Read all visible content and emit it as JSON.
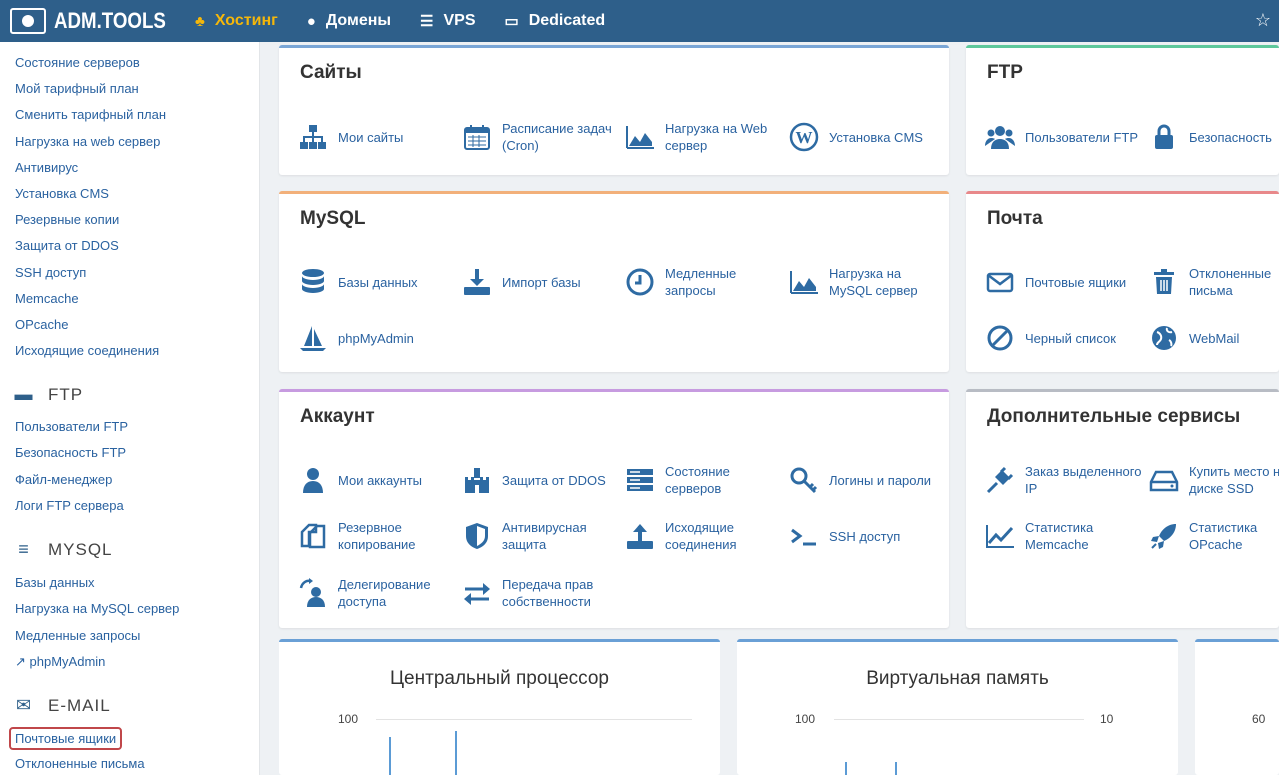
{
  "header": {
    "logo_text": "ADM.TOOLS",
    "nav": [
      {
        "label": "Хостинг",
        "icon": "sitemap-icon",
        "active": true
      },
      {
        "label": "Домены",
        "icon": "globe-icon",
        "active": false
      },
      {
        "label": "VPS",
        "icon": "server-icon",
        "active": false
      },
      {
        "label": "Dedicated",
        "icon": "hdd-icon",
        "active": false
      }
    ],
    "accent_color": "#f5b70a",
    "bar_color": "#2e5f8a"
  },
  "sidebar": {
    "hosting_links": [
      "Состояние серверов",
      "Мой тарифный план",
      "Сменить тарифный план",
      "Нагрузка на web сервер",
      "Антивирус",
      "Установка CMS",
      "Резервные копии",
      "Защита от DDOS",
      "SSH доступ",
      "Memcache",
      "OPcache",
      "Исходящие соединения"
    ],
    "ftp_title": "FTP",
    "ftp_links": [
      "Пользователи FTP",
      "Безопасность FTP",
      "Файл-менеджер",
      "Логи FTP сервера"
    ],
    "mysql_title": "MYSQL",
    "mysql_links": [
      "Базы данных",
      "Нагрузка на MySQL сервер",
      "Медленные запросы",
      "phpMyAdmin"
    ],
    "email_title": "E-MAIL",
    "email_links": [
      "Почтовые ящики",
      "Отклоненные письма"
    ]
  },
  "cards": {
    "sites": {
      "title": "Сайты",
      "tiles": [
        "Мои сайты",
        "Расписание задач (Cron)",
        "Нагрузка на Web сервер",
        "Установка CMS"
      ]
    },
    "ftp": {
      "title": "FTP",
      "tiles": [
        "Пользователи FTP",
        "Безопасность"
      ]
    },
    "mysql": {
      "title": "MySQL",
      "tiles": [
        "Базы данных",
        "Импорт базы",
        "Медленные запросы",
        "Нагрузка на MySQL сервер",
        "phpMyAdmin"
      ]
    },
    "mail": {
      "title": "Почта",
      "tiles": [
        "Почтовые ящики",
        "Отклоненные письма",
        "Черный список",
        "WebMail"
      ]
    },
    "account": {
      "title": "Аккаунт",
      "tiles": [
        "Мои аккаунты",
        "Защита от DDOS",
        "Состояние серверов",
        "Логины и пароли",
        "Резервное копирование",
        "Антивирусная защита",
        "Исходящие соединения",
        "SSH доступ",
        "Делегирование доступа",
        "Передача прав собственности"
      ]
    },
    "extra": {
      "title": "Дополнительные сервисы",
      "tiles": [
        "Заказ выделенного IP",
        "Купить место на диске SSD",
        "Статистика Memcache",
        "Статистика OPcache"
      ]
    }
  },
  "charts": {
    "cpu": {
      "title": "Центральный процессор",
      "y_top": "100"
    },
    "memory": {
      "title": "Виртуальная память",
      "y_top_left": "100",
      "y_top_right": "10"
    },
    "third": {
      "y_top": "60"
    }
  },
  "colors": {
    "sites_border": "#7aa6d6",
    "ftp_border": "#5ec89b",
    "mysql_border": "#f2b07a",
    "mail_border": "#e8888a",
    "account_border": "#c79be0",
    "extra_border": "#b8bcc4"
  }
}
